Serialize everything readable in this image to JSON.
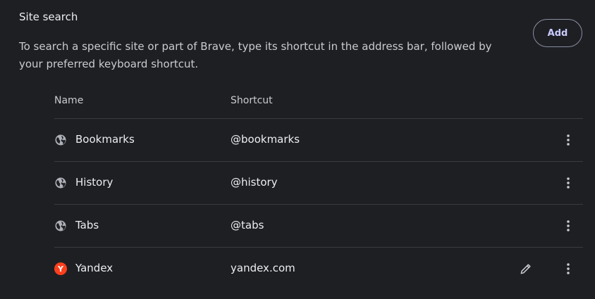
{
  "section": {
    "title": "Site search",
    "description": "To search a specific site or part of Brave, type its shortcut in the address bar, followed by your preferred keyboard shortcut.",
    "add_label": "Add"
  },
  "table": {
    "headers": {
      "name": "Name",
      "shortcut": "Shortcut"
    },
    "rows": [
      {
        "name": "Bookmarks",
        "shortcut": "@bookmarks",
        "icon": "globe-icon"
      },
      {
        "name": "History",
        "shortcut": "@history",
        "icon": "globe-icon"
      },
      {
        "name": "Tabs",
        "shortcut": "@tabs",
        "icon": "globe-icon"
      },
      {
        "name": "Yandex",
        "shortcut": "yandex.com",
        "icon": "yandex-icon",
        "badge_letter": "Y",
        "badge_color": "#fc3f1d"
      }
    ]
  },
  "colors": {
    "background": "#1e1f23",
    "accent": "#c9ccff",
    "divider": "#3a3b40"
  }
}
